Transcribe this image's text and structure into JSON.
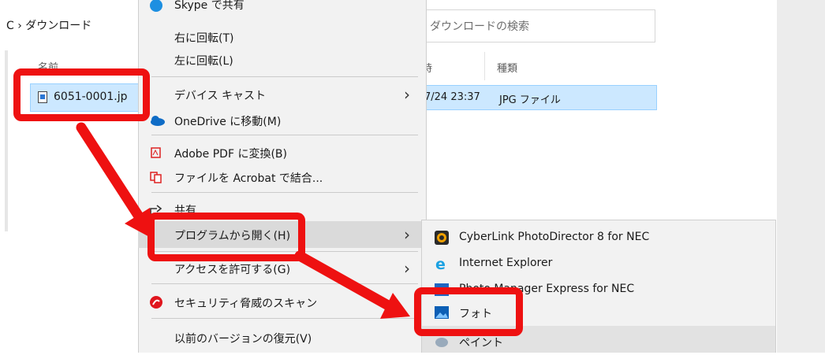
{
  "explorer": {
    "breadcrumb": "C › ダウンロード",
    "search_placeholder": "ダウンロードの検索",
    "columns": {
      "name": "名前",
      "date": "時",
      "type": "種類"
    },
    "file": {
      "name": "6051-0001.jp",
      "date": "7/24 23:37",
      "type": "JPG ファイル"
    }
  },
  "context_menu": {
    "items": [
      {
        "label": "Skype で共有"
      },
      {
        "label": "右に回転(T)"
      },
      {
        "label": "左に回転(L)"
      },
      {
        "label": "デバイス キャスト"
      },
      {
        "label": "OneDrive に移動(M)"
      },
      {
        "label": "Adobe PDF に変換(B)"
      },
      {
        "label": "ファイルを Acrobat で結合..."
      },
      {
        "label": "共有"
      },
      {
        "label": "プログラムから開く(H)"
      },
      {
        "label": "アクセスを許可する(G)"
      },
      {
        "label": "セキュリティ脅威のスキャン"
      },
      {
        "label": "以前のバージョンの復元(V)"
      }
    ],
    "submenu_arrow": "›"
  },
  "open_with_submenu": {
    "items": [
      {
        "label": "CyberLink PhotoDirector 8 for NEC"
      },
      {
        "label": "Internet Explorer"
      },
      {
        "label": "Photo Manager Express for NEC"
      },
      {
        "label": "フォト"
      },
      {
        "label": "ペイント"
      }
    ]
  },
  "annotations": {
    "color": "#ee1111"
  }
}
